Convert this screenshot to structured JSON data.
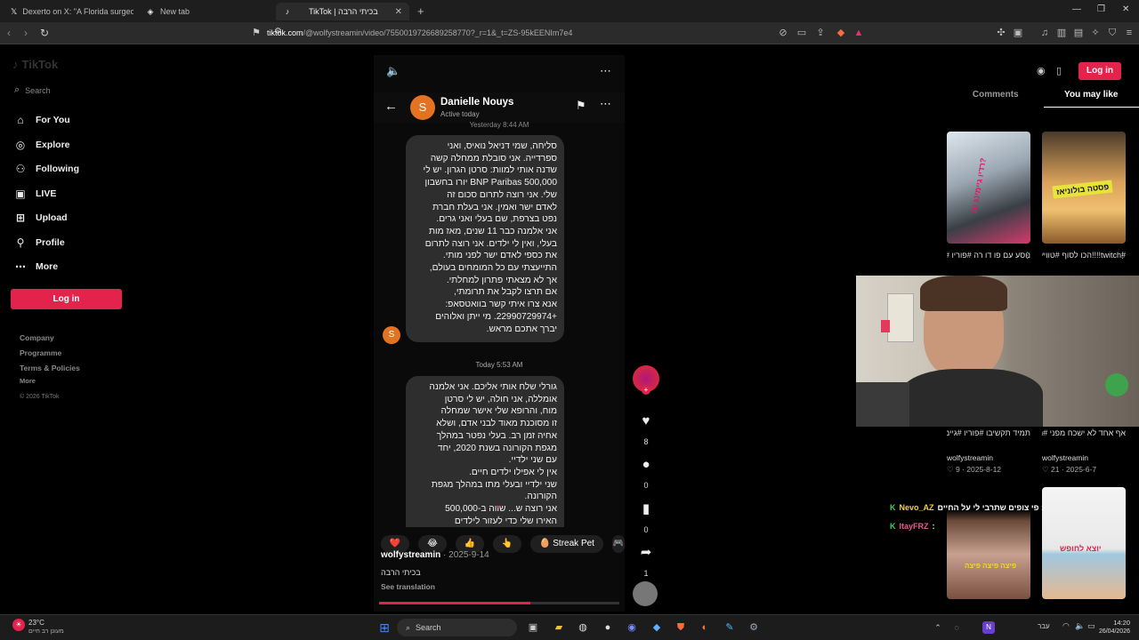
{
  "browser": {
    "tabs": [
      {
        "label": "Dexerto on X: \"A Florida surgeon tur",
        "icon": "x-logo-icon"
      },
      {
        "label": "New tab",
        "icon": "brave-shield-icon"
      },
      {
        "label": "TikTok | בכיתי הרבה",
        "icon": "tiktok-icon"
      }
    ],
    "new_tab": "+",
    "url_host": "tiktok.com",
    "url_path": "/@wolfystreamin/video/7550019726689258770?_r=1&_t=ZS-95kEENIm7e4"
  },
  "tiktok": {
    "logo": "TikTok",
    "search_placeholder": "Search",
    "nav": [
      {
        "label": "For You",
        "icon": "home-icon"
      },
      {
        "label": "Explore",
        "icon": "compass-icon"
      },
      {
        "label": "Following",
        "icon": "following-icon"
      },
      {
        "label": "LIVE",
        "icon": "live-icon"
      },
      {
        "label": "Upload",
        "icon": "upload-icon"
      },
      {
        "label": "Profile",
        "icon": "profile-icon"
      },
      {
        "label": "More",
        "icon": "more-icon"
      }
    ],
    "login": "Log in",
    "footer": [
      "Company",
      "Programme",
      "Terms & Policies",
      "More"
    ],
    "copyright": "© 2026 TikTok",
    "header_login": "Log in"
  },
  "dm": {
    "name": "Danielle Nouys",
    "status": "Active today",
    "avatar_letter": "S",
    "yesterday_stamp": "Yesterday 8:44 AM",
    "today_stamp": "Today 5:53 AM",
    "message1": [
      "סליחה, שמי דניאל נואיס, ואני",
      "ספרדייה. אני סובלת ממחלה קשה",
      "שדנה אותי למוות: סרטן הגרון. יש לי",
      "BNP Paribas 500,000 יורו בחשבון",
      "שלי. אני רוצה לתרום סכום זה",
      "לאדם ישר ואמין. אני בעלת חברת",
      "נפט בצרפת, שם בעלי ואני גרים.",
      "אני אלמנה כבר 11 שנים, מאז מות",
      "בעלי, ואין לי ילדים. אני רוצה לתרום",
      "את כספי לאדם ישר לפני מותי.",
      "התייעצתי עם כל המומחים בעולם,",
      "אך לא מצאתי פתרון למחלתי.",
      "אם תרצו לקבל את תרומתי,",
      "אנא צרו איתי קשר בוואטסאפ:",
      "+22990729974. מי ייתן ואלוהים",
      "יברך אתכם מראש."
    ],
    "message2": [
      "גורלי שלח אותי אליכם. אני אלמנה",
      "אומללה, אני חולה, יש לי סרטן",
      "מוח, והרופא שלי אישר שמחלה",
      "זו מסוכנת מאוד לבני אדם, ושלא",
      "אחיה זמן רב. בעלי נפטר במהלך",
      "מגפת הקורונה בשנת 2020, יחד",
      "עם שני ילדיי.",
      "אין לי אפילו ילדים חיים.",
      "שני ילדיי ובעלי מתו במהלך מגפת",
      "הקורונה.",
      "אני רוצה ש... שווה ב-500,000",
      "האירו שלי כדי לעזור לילדים"
    ]
  },
  "reactions": [
    "❤️",
    "😂",
    "👍",
    "👆",
    "Streak Pet",
    "🎮"
  ],
  "video": {
    "author": "wolfystreamin",
    "date": "2025-9-14",
    "caption": "בכיתי הרבה",
    "see_translation": "See translation",
    "progress": 0.63,
    "likes": "8",
    "comments": "0",
    "saves": "0",
    "shares": "1"
  },
  "right_panel": {
    "tabs": [
      "Comments",
      "You may like"
    ],
    "cards": [
      {
        "caption": "נוסע עם פו דו רה #פוריו #גיימינג #טוויץ",
        "sticker": "רדיו גיימינג 10?"
      },
      {
        "caption": "#twitch!!!!הכו לסוף #טוויץ#אלתחפשו...",
        "sticker": "פסטה בולוניאז"
      },
      {
        "caption": "תמיד תקשיבו #פוריו #גיימינג #לצליל",
        "user": "wolfystreamin",
        "likes": "9",
        "date": "2025-8-12"
      },
      {
        "caption": "אף אחד לא ישכח מפני #twitch #החוק #טוויץ",
        "user": "wolfystreamin",
        "likes": "21",
        "date": "2025-6-7"
      }
    ],
    "stickers": [
      "פיצה פיצה פיצה",
      "יוצא לחופש"
    ],
    "chat": [
      {
        "user": "Nevo_AZ",
        "text": ": פי צופים שתרבי לי על החיים"
      },
      {
        "user": "ItayFRZ",
        "text": ":"
      }
    ]
  },
  "taskbar": {
    "weather_temp": "23°C",
    "weather_desc": "מעונן רב חיים",
    "search": "Search",
    "lang": "עבר",
    "time": "14:20",
    "date": "26/04/2026"
  }
}
